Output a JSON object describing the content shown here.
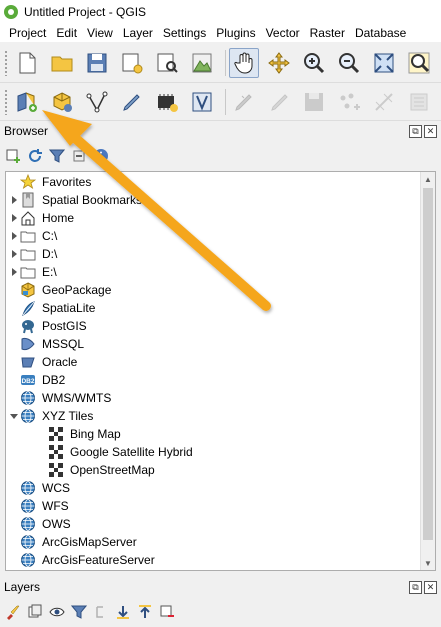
{
  "window": {
    "title": "Untitled Project - QGIS"
  },
  "menubar": {
    "items": [
      {
        "label": "Project"
      },
      {
        "label": "Edit"
      },
      {
        "label": "View"
      },
      {
        "label": "Layer"
      },
      {
        "label": "Settings"
      },
      {
        "label": "Plugins"
      },
      {
        "label": "Vector"
      },
      {
        "label": "Raster"
      },
      {
        "label": "Database"
      }
    ]
  },
  "toolbar1": {
    "icons": [
      "new-project-icon",
      "open-project-icon",
      "save-project-icon",
      "new-print-layout-icon",
      "layout-manager-icon",
      "style-manager-icon",
      "pan-icon",
      "pan-to-selection-icon",
      "zoom-in-icon",
      "zoom-out-icon",
      "zoom-full-icon",
      "zoom-to-selection-icon"
    ]
  },
  "toolbar2": {
    "icons": [
      "data-source-manager-icon",
      "new-geopackage-layer-icon",
      "vertex-tool-icon",
      "digitize-icon",
      "new-temporary-layer-icon",
      "identify-features-icon",
      "toggle-editing-icon",
      "add-feature-icon",
      "save-edits-icon",
      "add-point-icon",
      "node-tool-icon",
      "delete-selected-icon"
    ]
  },
  "browser_panel": {
    "title": "Browser",
    "tree": [
      {
        "label": "Favorites",
        "icon": "star-icon",
        "expandable": false,
        "level": 0
      },
      {
        "label": "Spatial Bookmarks",
        "icon": "bookmark-icon",
        "expandable": true,
        "level": 0
      },
      {
        "label": "Home",
        "icon": "home-icon",
        "expandable": true,
        "level": 0
      },
      {
        "label": "C:\\",
        "icon": "folder-icon",
        "expandable": true,
        "level": 0
      },
      {
        "label": "D:\\",
        "icon": "folder-icon",
        "expandable": true,
        "level": 0
      },
      {
        "label": "E:\\",
        "icon": "folder-icon",
        "expandable": true,
        "level": 0
      },
      {
        "label": "GeoPackage",
        "icon": "geopackage-icon",
        "expandable": false,
        "level": 0
      },
      {
        "label": "SpatiaLite",
        "icon": "spatialite-icon",
        "expandable": false,
        "level": 0
      },
      {
        "label": "PostGIS",
        "icon": "postgis-icon",
        "expandable": false,
        "level": 0
      },
      {
        "label": "MSSQL",
        "icon": "mssql-icon",
        "expandable": false,
        "level": 0
      },
      {
        "label": "Oracle",
        "icon": "oracle-icon",
        "expandable": false,
        "level": 0
      },
      {
        "label": "DB2",
        "icon": "db2-icon",
        "expandable": false,
        "level": 0
      },
      {
        "label": "WMS/WMTS",
        "icon": "globe-icon",
        "expandable": false,
        "level": 0
      },
      {
        "label": "XYZ Tiles",
        "icon": "globe-icon",
        "expandable": true,
        "expanded": true,
        "level": 0
      },
      {
        "label": "Bing Map",
        "icon": "xyz-tile-icon",
        "expandable": false,
        "level": 1
      },
      {
        "label": "Google Satellite Hybrid",
        "icon": "xyz-tile-icon",
        "expandable": false,
        "level": 1
      },
      {
        "label": "OpenStreetMap",
        "icon": "xyz-tile-icon",
        "expandable": false,
        "level": 1
      },
      {
        "label": "WCS",
        "icon": "globe-icon",
        "expandable": false,
        "level": 0
      },
      {
        "label": "WFS",
        "icon": "globe-icon",
        "expandable": false,
        "level": 0
      },
      {
        "label": "OWS",
        "icon": "globe-icon",
        "expandable": false,
        "level": 0
      },
      {
        "label": "ArcGisMapServer",
        "icon": "globe-icon",
        "expandable": false,
        "level": 0
      },
      {
        "label": "ArcGisFeatureServer",
        "icon": "globe-icon",
        "expandable": false,
        "level": 0
      }
    ]
  },
  "layers_panel": {
    "title": "Layers"
  },
  "colors": {
    "arrow": "#f5a61e",
    "accent": "#5aab3a"
  }
}
